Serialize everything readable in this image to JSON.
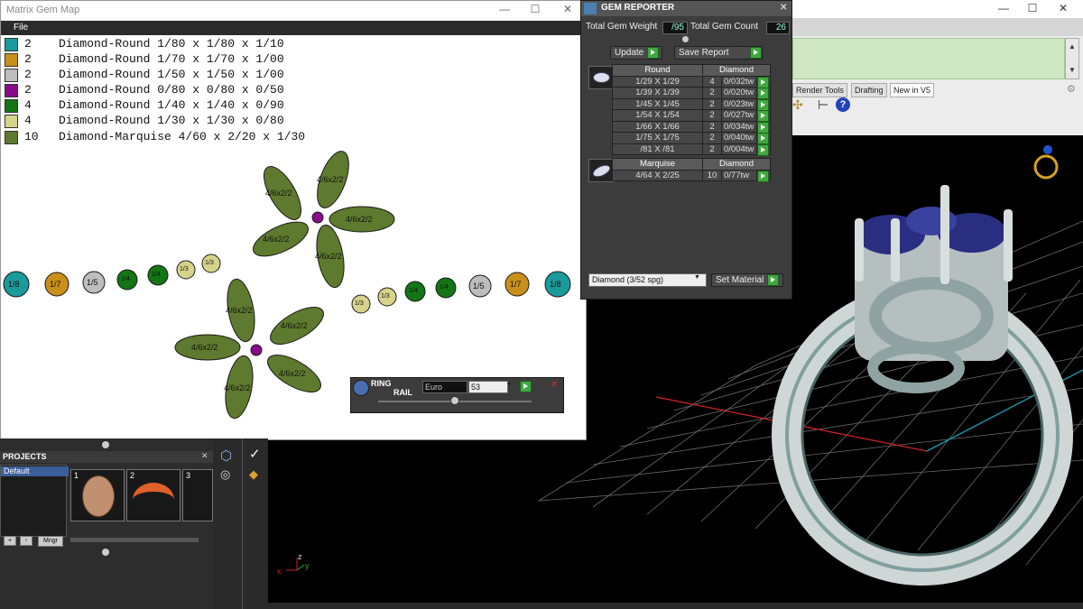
{
  "gem_map": {
    "title": "Matrix Gem Map",
    "menu_file": "File",
    "window_controls": [
      "—",
      "☐",
      "✕"
    ],
    "legend": [
      {
        "color": "#1a9a9a",
        "count": "2",
        "desc": "Diamond-Round 1/80 x 1/80 x 1/10"
      },
      {
        "color": "#c8901a",
        "count": "2",
        "desc": "Diamond-Round 1/70 x 1/70 x 1/00"
      },
      {
        "color": "#bdbdbd",
        "count": "2",
        "desc": "Diamond-Round 1/50 x 1/50 x 1/00"
      },
      {
        "color": "#8a0a8a",
        "count": "2",
        "desc": "Diamond-Round 0/80 x 0/80 x 0/50"
      },
      {
        "color": "#137513",
        "count": "4",
        "desc": "Diamond-Round 1/40 x 1/40 x 0/90"
      },
      {
        "color": "#d6d38a",
        "count": "4",
        "desc": "Diamond-Round 1/30 x 1/30 x 0/80"
      },
      {
        "color": "#5e7a2e",
        "count": "10",
        "desc": "Diamond-Marquise 4/60 x 2/20 x 1/30"
      }
    ],
    "round_labels": [
      "1/8",
      "1/7",
      "1/5",
      "1/4",
      "1/4",
      "1/3",
      "1/3"
    ],
    "round_labels_right": [
      "1/3",
      "1/3",
      "1/4",
      "1/4",
      "1/5",
      "1/7",
      "1/8"
    ],
    "marquise_label": "4/6x2/2"
  },
  "reporter": {
    "title": "GEM REPORTER",
    "total_weight_label": "Total Gem Weight",
    "total_weight_value": "/95",
    "total_count_label": "Total Gem Count",
    "total_count_value": "26",
    "update_label": "Update",
    "save_report_label": "Save Report",
    "round_header": "Round",
    "diamond_header": "Diamond",
    "round_rows": [
      {
        "size": "1/29 X 1/29",
        "count": "4",
        "weight": "0/032tw"
      },
      {
        "size": "1/39 X 1/39",
        "count": "2",
        "weight": "0/020tw"
      },
      {
        "size": "1/45 X 1/45",
        "count": "2",
        "weight": "0/023tw"
      },
      {
        "size": "1/54 X 1/54",
        "count": "2",
        "weight": "0/027tw"
      },
      {
        "size": "1/66 X 1/66",
        "count": "2",
        "weight": "0/034tw"
      },
      {
        "size": "1/75 X 1/75",
        "count": "2",
        "weight": "0/040tw"
      },
      {
        "size": "/81 X /81",
        "count": "2",
        "weight": "0/004tw"
      }
    ],
    "marquise_header": "Marquise",
    "marquise_diamond_header": "Diamond",
    "marquise_rows": [
      {
        "size": "4/64 X 2/25",
        "count": "10",
        "weight": "0/77tw"
      }
    ],
    "material_value": "Diamond   (3/52 spg)",
    "set_material_label": "Set Material"
  },
  "ring_rail": {
    "label_line1": "RING",
    "label_line2": "RAIL",
    "unit_value": "Euro",
    "size_value": "53"
  },
  "projects": {
    "title": "PROJECTS",
    "default_item": "Default",
    "thumb_numbers": [
      "1",
      "2",
      "3"
    ],
    "mngr_label": "Mngr"
  },
  "host_window": {
    "tabs": [
      "Render Tools",
      "Drafting",
      "New in V5"
    ],
    "window_controls": [
      "—",
      "☐",
      "✕"
    ]
  },
  "axis": {
    "x": "x",
    "y": "y",
    "z": "z"
  }
}
